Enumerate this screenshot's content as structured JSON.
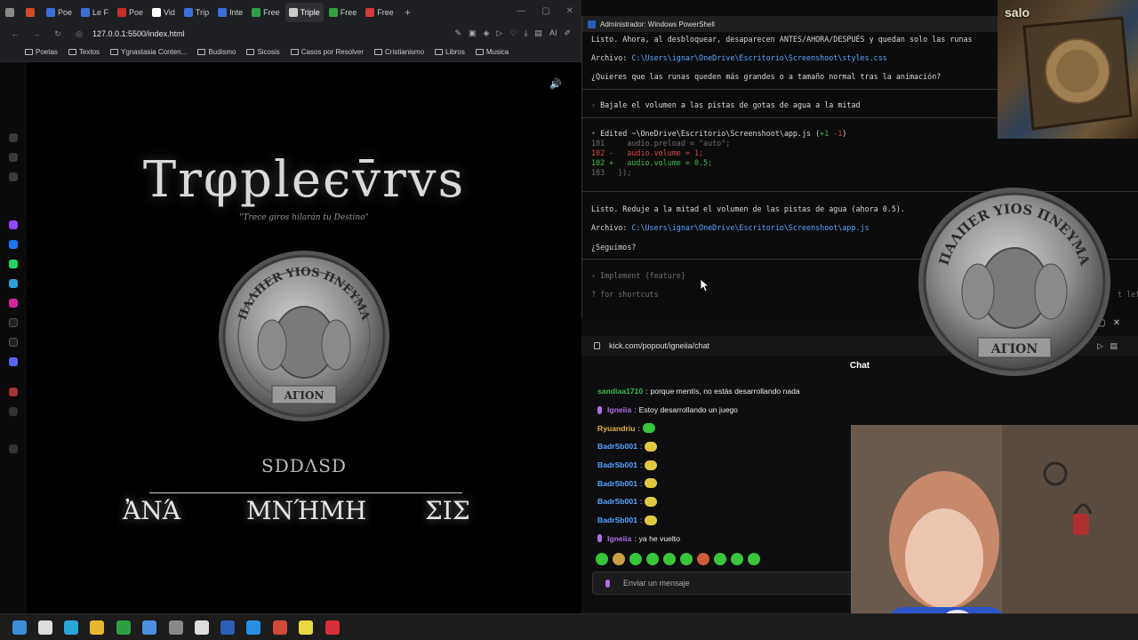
{
  "browser": {
    "tabs": [
      {
        "label": "",
        "color": "#8a8a8a"
      },
      {
        "label": "",
        "color": "#d04a2a"
      },
      {
        "label": "Poe",
        "color": "#3a6fd8"
      },
      {
        "label": "Le F",
        "color": "#3a6fd8"
      },
      {
        "label": "Poe",
        "color": "#c8302a"
      },
      {
        "label": "Vid",
        "color": "#ffffff"
      },
      {
        "label": "Trip",
        "color": "#3a6fd8"
      },
      {
        "label": "Inte",
        "color": "#3a6fd8"
      },
      {
        "label": "Free",
        "color": "#2ea043"
      },
      {
        "label": "Triple",
        "color": "#cccccc",
        "active": true
      },
      {
        "label": "Free",
        "color": "#2ea043"
      },
      {
        "label": "Free",
        "color": "#d93a3a"
      }
    ],
    "url": "127.0.0.1:5500/index.html",
    "bookmarks": [
      "Poetas",
      "Textos",
      "Ygnastasia Conten...",
      "Budismo",
      "Sicosis",
      "Casos por Resolver",
      "Cristianismo",
      "Libros",
      "Musica"
    ]
  },
  "game": {
    "title": "Trφpleϵv̄rvs",
    "subtitle": "\"Trece giros hilarán tu Destino\"",
    "coin": {
      "top": "ΠΑΛΠΕR ΥΙΟS ΠΝΕΥΜΑ",
      "bottom": "ΑΓΙΟΝ"
    },
    "rune_word": "SDDΛSD",
    "options": [
      "ἈΝΆ",
      "ΜΝΉΜΗ",
      "ΣΙΣ"
    ]
  },
  "powershell": {
    "title": "Administrador: Windows PowerShell",
    "lines": {
      "l1": "Listo. Ahora, al desbloquear, desaparecen ANTES/AHORA/DESPUÉS y quedan solo las runas",
      "archivo_label": "Archivo: ",
      "path1": "C:\\Users\\ignar\\OneDrive\\Escritorio\\Screenshoot\\styles.css",
      "q1": "¿Quieres que las runas queden más grandes o a tamaño normal tras la animación?",
      "user_msg": "Bajale el volumen a las pistas de gotas de agua a la mitad",
      "edited": "Edited ~\\OneDrive\\Escritorio\\Screenshoot\\app.js",
      "edited_stats_plus": "+1",
      "edited_stats_minus": "-1",
      "code101": "101     audio.preload = \"auto\";",
      "code102a": "102 -   audio.volume = 1;",
      "code102b": "102 +   audio.volume = 0.5;",
      "code103": "103   });",
      "l2": "Listo. Reduje a la mitad el volumen de las pistas de agua (ahora 0.5).",
      "path2": "C:\\Users\\ignar\\OneDrive\\Escritorio\\Screenshoot\\app.js",
      "q2": "¿Seguimos?",
      "prompt": "Implement {feature}",
      "shortcuts": "? for shortcuts",
      "right_hint": "t left"
    }
  },
  "chat": {
    "url": "kick.com/popout/igneiia/chat",
    "header": "Chat",
    "messages": [
      {
        "user": "sandiaa1710",
        "text": "porque mentís, no estás desarrollando nada",
        "color": "#3fb950"
      },
      {
        "user": "Igneiia",
        "text": "Estoy desarrollando un juego",
        "color": "#b06ee8",
        "mic": true
      },
      {
        "user": "Ryuandriu",
        "text": "",
        "color": "#e3b341",
        "emote": "#39c63a"
      },
      {
        "user": "BadrSb001",
        "text": "",
        "color": "#58a6ff",
        "emote": "#e0c840"
      },
      {
        "user": "BadrSb001",
        "text": "",
        "color": "#58a6ff",
        "emote": "#e0c840"
      },
      {
        "user": "BadrSb001",
        "text": "",
        "color": "#58a6ff",
        "emote": "#e0c840"
      },
      {
        "user": "BadrSb001",
        "text": "",
        "color": "#58a6ff",
        "emote": "#e0c840"
      },
      {
        "user": "BadrSb001",
        "text": "",
        "color": "#58a6ff",
        "emote": "#e0c840"
      },
      {
        "user": "Igneiia",
        "text": "ya he vuelto",
        "color": "#b06ee8",
        "mic": true
      }
    ],
    "emote_bar_colors": [
      "#39c63a",
      "#c8a040",
      "#39c63a",
      "#39c63a",
      "#39c63a",
      "#39c63a",
      "#d05a3a",
      "#39c63a",
      "#39c63a",
      "#39c63a"
    ],
    "input_placeholder": "Enviar un mensaje"
  },
  "overlay": {
    "book_label": "salo"
  },
  "taskbar": {
    "icons": [
      {
        "name": "windows-start-icon",
        "color": "#3a8fd8"
      },
      {
        "name": "search-icon",
        "color": "#dddddd"
      },
      {
        "name": "edge-icon",
        "color": "#2aa6d8"
      },
      {
        "name": "file-explorer-icon",
        "color": "#e8b830"
      },
      {
        "name": "whatsapp-icon",
        "color": "#2ea043"
      },
      {
        "name": "store-icon",
        "color": "#4a8fe0"
      },
      {
        "name": "app-icon",
        "color": "#888888"
      },
      {
        "name": "chatgpt-icon",
        "color": "#dddddd"
      },
      {
        "name": "powershell-icon",
        "color": "#2b5fb8"
      },
      {
        "name": "vscode-icon",
        "color": "#2a8fe0"
      },
      {
        "name": "chrome-icon",
        "color": "#d04a3a"
      },
      {
        "name": "notes-icon",
        "color": "#e8d840"
      },
      {
        "name": "opera-icon",
        "color": "#d8303a"
      }
    ]
  }
}
